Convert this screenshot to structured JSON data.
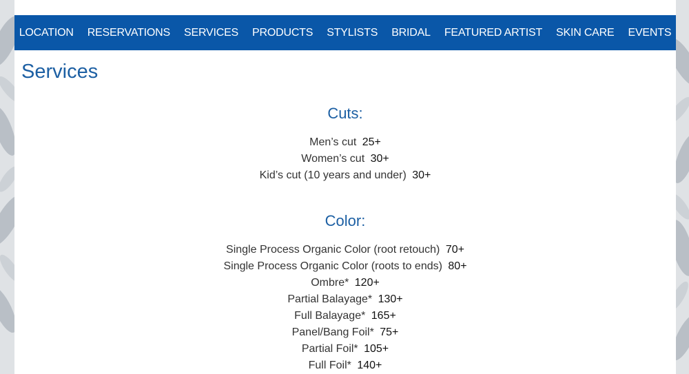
{
  "nav": {
    "items": [
      {
        "label": "LOCATION"
      },
      {
        "label": "RESERVATIONS"
      },
      {
        "label": "SERVICES"
      },
      {
        "label": "PRODUCTS"
      },
      {
        "label": "STYLISTS"
      },
      {
        "label": "BRIDAL"
      },
      {
        "label": "FEATURED ARTIST"
      },
      {
        "label": "SKIN CARE"
      },
      {
        "label": "EVENTS"
      }
    ]
  },
  "page": {
    "title": "Services"
  },
  "sections": {
    "cuts": {
      "heading": "Cuts:",
      "items": [
        {
          "name": "Men’s cut",
          "price": "25+"
        },
        {
          "name": "Women’s cut",
          "price": "30+"
        },
        {
          "name": "Kid’s cut (10 years and under)",
          "price": "30+"
        }
      ]
    },
    "color": {
      "heading": "Color:",
      "items": [
        {
          "name": "Single Process Organic Color (root retouch)",
          "price": "70+"
        },
        {
          "name": "Single Process Organic Color (roots to ends)",
          "price": "80+"
        },
        {
          "name": "Ombre*",
          "price": "120+"
        },
        {
          "name": "Partial Balayage*",
          "price": "130+"
        },
        {
          "name": "Full Balayage*",
          "price": "165+"
        },
        {
          "name": "Panel/Bang Foil*",
          "price": "75+"
        },
        {
          "name": "Partial Foil*",
          "price": "105+"
        },
        {
          "name": "Full Foil*",
          "price": "140+"
        }
      ]
    }
  },
  "colors": {
    "nav_background": "#0a57a8",
    "heading": "#1c5fa3",
    "body_text": "#333333",
    "page_background": "#ffffff",
    "backdrop": "#dfe2e5"
  }
}
